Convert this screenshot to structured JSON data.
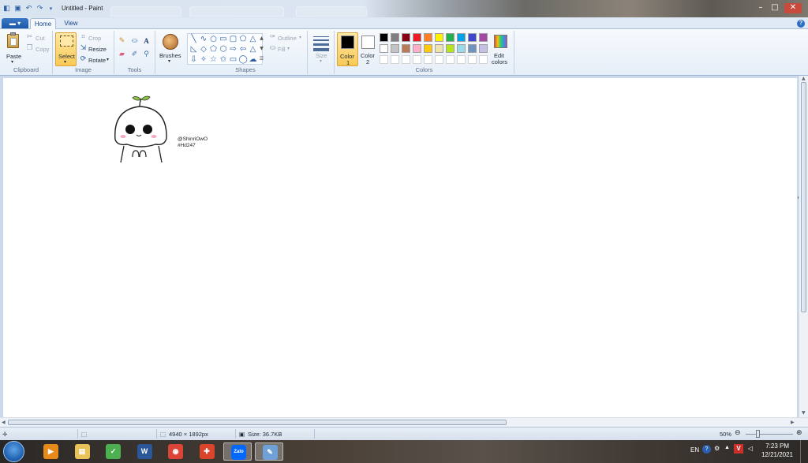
{
  "window": {
    "title": "Untitled - Paint",
    "controls": {
      "minimize": "–",
      "maximize": "□",
      "close": "✕"
    }
  },
  "ribbon_tabs": [
    {
      "label": "Home",
      "active": true
    },
    {
      "label": "View",
      "active": false
    }
  ],
  "clipboard": {
    "paste": "Paste",
    "cut": "Cut",
    "copy": "Copy",
    "label": "Clipboard"
  },
  "image": {
    "select": "Select",
    "crop": "Crop",
    "resize": "Resize",
    "rotate": "Rotate",
    "label": "Image"
  },
  "tools": {
    "label": "Tools",
    "items": [
      "pencil-icon",
      "fill-icon",
      "text-icon",
      "eraser-icon",
      "color-picker-icon",
      "magnifier-icon"
    ]
  },
  "brushes": {
    "label": "Brushes"
  },
  "shapes": {
    "label": "Shapes",
    "outline": "Outline",
    "fill": "Fill",
    "glyphs": [
      "╲",
      "∿",
      "○",
      "▭",
      "▢",
      "⬠",
      "△",
      "◺",
      "◇",
      "⬠",
      "⬡",
      "⇨",
      "⇦",
      "△",
      "⇩",
      "✧",
      "☆",
      "✩",
      "▭",
      "◯",
      "☁"
    ]
  },
  "size": {
    "label": "Size"
  },
  "colors": {
    "label": "Colors",
    "color1_label_a": "Color",
    "color1_label_b": "1",
    "color2_label_a": "Color",
    "color2_label_b": "2",
    "edit_a": "Edit",
    "edit_b": "colors",
    "color1": "#000000",
    "color2": "#ffffff",
    "palette_row1": [
      "#000000",
      "#7f7f7f",
      "#880015",
      "#ed1c24",
      "#ff7f27",
      "#fff200",
      "#22b14c",
      "#00a2e8",
      "#3f48cc",
      "#a349a4"
    ],
    "palette_row2": [
      "#ffffff",
      "#c3c3c3",
      "#b97a57",
      "#ffaec9",
      "#ffc90e",
      "#efe4b0",
      "#b5e61d",
      "#99d9ea",
      "#7092be",
      "#c8bfe7"
    ],
    "palette_row3": [
      "#ffffff",
      "#ffffff",
      "#ffffff",
      "#ffffff",
      "#ffffff",
      "#ffffff",
      "#ffffff",
      "#ffffff",
      "#ffffff",
      "#ffffff"
    ]
  },
  "canvas": {
    "signature_line1": "@ShinriOwO",
    "signature_line2": "#Hd247"
  },
  "status": {
    "dimensions": "4940 × 1892px",
    "size": "Size: 36.7KB",
    "zoom": "50%"
  },
  "taskbar": {
    "apps": [
      {
        "name": "media-player-icon",
        "color": "#e88a1a",
        "glyph": "▶",
        "active": false
      },
      {
        "name": "file-explorer-icon",
        "color": "#e9c25a",
        "glyph": "▤",
        "active": false
      },
      {
        "name": "green-app-icon",
        "color": "#4caf50",
        "glyph": "✓",
        "active": false
      },
      {
        "name": "word-icon",
        "color": "#2b579a",
        "glyph": "W",
        "active": false
      },
      {
        "name": "chrome-icon",
        "color": "#db4437",
        "glyph": "◉",
        "active": false
      },
      {
        "name": "security-shield-icon",
        "color": "#d9442b",
        "glyph": "✚",
        "active": false
      },
      {
        "name": "zalo-icon",
        "color": "#0068ff",
        "glyph": "Zalo",
        "active": true
      },
      {
        "name": "paint-icon",
        "color": "#6fa1d8",
        "glyph": "✎",
        "active": true
      }
    ],
    "lang": "EN",
    "time": "7:23 PM",
    "date": "12/21/2021"
  }
}
